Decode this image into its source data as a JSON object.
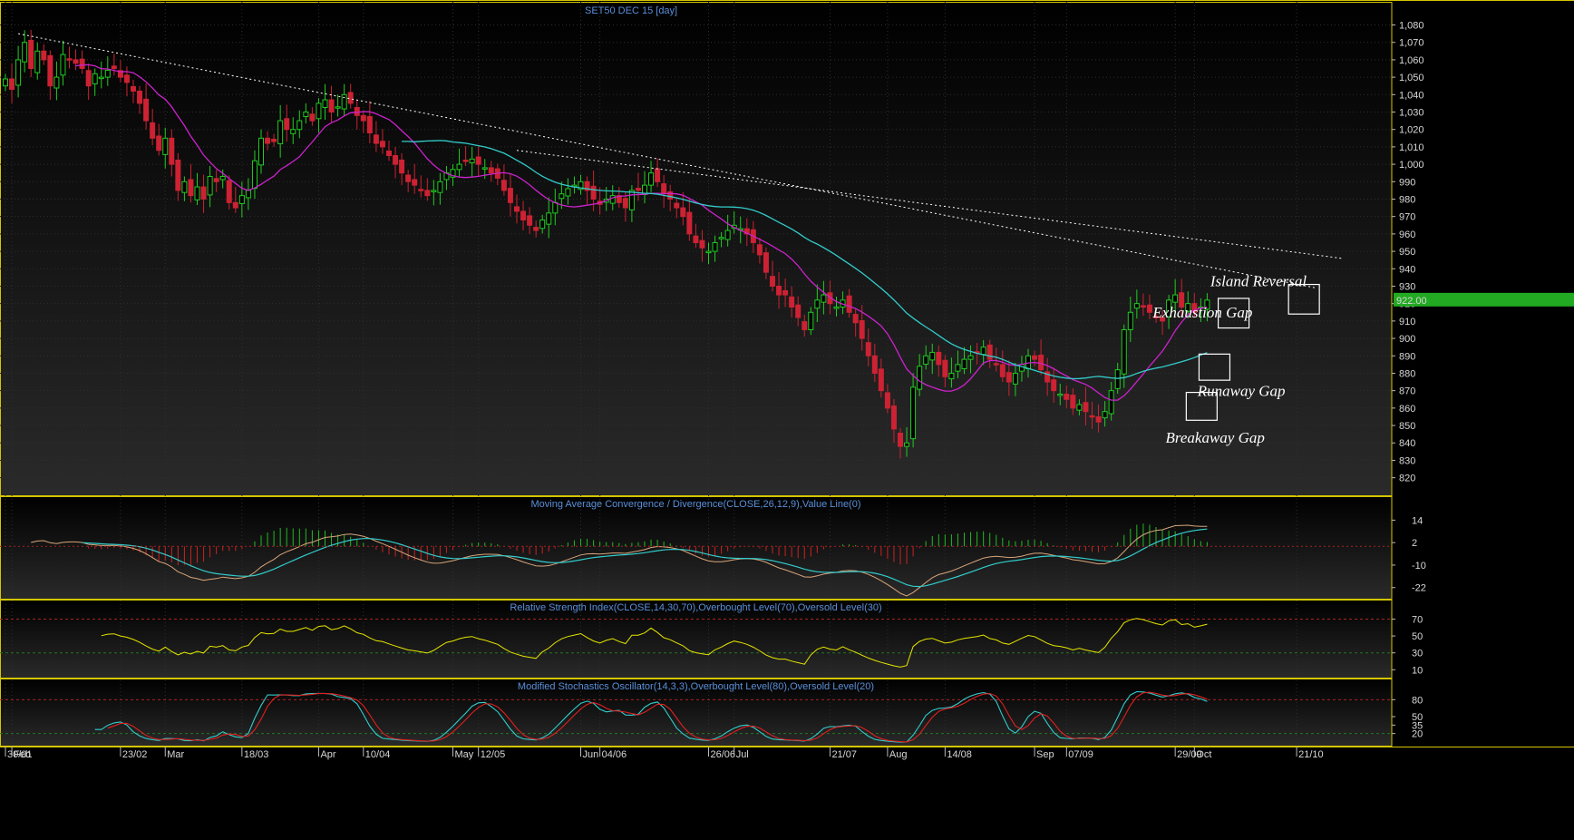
{
  "chart_data": [
    {
      "type": "candlestick",
      "panel": "price",
      "title": "SET50 DEC 15   [day]",
      "last_price_label": "922.00",
      "yticks": [
        820,
        830,
        840,
        850,
        860,
        870,
        880,
        890,
        900,
        910,
        920,
        930,
        940,
        950,
        960,
        970,
        980,
        990,
        1000,
        1010,
        1020,
        1030,
        1040,
        1050,
        1060,
        1070,
        1080
      ],
      "ytick_labels": [
        "820",
        "830",
        "840",
        "850",
        "860",
        "870",
        "880",
        "890",
        "900",
        "910",
        "920",
        "930",
        "940",
        "950",
        "960",
        "970",
        "980",
        "990",
        "1,000",
        "1,010",
        "1,020",
        "1,030",
        "1,040",
        "1,050",
        "1,060",
        "1,070",
        "1,080"
      ],
      "ylim": [
        812,
        1086
      ],
      "x_axis_labels": [
        {
          "bar": 0,
          "text": "30/01"
        },
        {
          "bar": 1,
          "text": "Feb"
        },
        {
          "bar": 18,
          "text": "23/02"
        },
        {
          "bar": 25,
          "text": "Mar"
        },
        {
          "bar": 37,
          "text": "18/03"
        },
        {
          "bar": 49,
          "text": "Apr"
        },
        {
          "bar": 56,
          "text": "10/04"
        },
        {
          "bar": 70,
          "text": "May"
        },
        {
          "bar": 74,
          "text": "12/05"
        },
        {
          "bar": 90,
          "text": "Jun"
        },
        {
          "bar": 93,
          "text": "04/06"
        },
        {
          "bar": 110,
          "text": "26/06"
        },
        {
          "bar": 114,
          "text": "Jul"
        },
        {
          "bar": 129,
          "text": "21/07"
        },
        {
          "bar": 138,
          "text": "Aug"
        },
        {
          "bar": 147,
          "text": "14/08"
        },
        {
          "bar": 161,
          "text": "Sep"
        },
        {
          "bar": 166,
          "text": "07/09"
        },
        {
          "bar": 183,
          "text": "29/09"
        },
        {
          "bar": 186,
          "text": "Oct"
        },
        {
          "bar": 202,
          "text": "21/10"
        }
      ],
      "close": [
        1049,
        1043,
        1060,
        1070,
        1055,
        1065,
        1060,
        1045,
        1050,
        1063,
        1060,
        1058,
        1055,
        1045,
        1052,
        1050,
        1054,
        1055,
        1050,
        1047,
        1042,
        1035,
        1025,
        1015,
        1008,
        1015,
        1000,
        985,
        990,
        982,
        987,
        980,
        993,
        990,
        993,
        978,
        975,
        982,
        985,
        1002,
        1015,
        1012,
        1013,
        1025,
        1020,
        1020,
        1025,
        1030,
        1025,
        1035,
        1037,
        1030,
        1033,
        1040,
        1035,
        1028,
        1025,
        1018,
        1012,
        1010,
        1005,
        1000,
        995,
        990,
        988,
        985,
        982,
        985,
        990,
        995,
        997,
        1000,
        1002,
        1003,
        1000,
        998,
        995,
        992,
        985,
        978,
        973,
        968,
        965,
        962,
        968,
        972,
        978,
        983,
        986,
        988,
        990,
        985,
        980,
        977,
        980,
        982,
        978,
        975,
        985,
        985,
        988,
        995,
        990,
        983,
        980,
        975,
        970,
        960,
        955,
        952,
        950,
        955,
        958,
        962,
        965,
        963,
        960,
        955,
        948,
        938,
        930,
        925,
        925,
        918,
        912,
        905,
        915,
        922,
        925,
        920,
        918,
        922,
        915,
        909,
        900,
        890,
        880,
        870,
        860,
        848,
        838,
        840,
        872,
        884,
        890,
        892,
        885,
        878,
        880,
        885,
        888,
        890,
        892,
        895,
        888,
        885,
        878,
        875,
        880,
        885,
        890,
        888,
        882,
        875,
        870,
        868,
        865,
        860,
        862,
        858,
        855,
        852,
        858,
        870,
        882,
        905,
        915,
        920,
        918,
        915,
        912,
        910,
        922,
        925,
        918,
        920,
        915,
        918,
        922
      ],
      "ma_magenta_period": "approx 20-day",
      "ma_cyan_period": "approx 50-day",
      "annotations": [
        {
          "text": "Island Reversal",
          "bar": 197,
          "price": 930
        },
        {
          "text": "Exhaustion Gap",
          "bar": 188,
          "price": 912
        },
        {
          "text": "Runaway Gap",
          "bar": 195,
          "price": 867
        },
        {
          "text": "Breakaway Gap",
          "bar": 190,
          "price": 840
        }
      ],
      "gap_boxes": [
        {
          "bar": 187,
          "low": 853,
          "high": 862
        },
        {
          "bar": 189,
          "low": 876,
          "high": 884
        },
        {
          "bar": 192,
          "low": 906,
          "high": 916
        },
        {
          "bar": 203,
          "low": 914,
          "high": 924
        }
      ],
      "trendlines": [
        {
          "from_bar": 2,
          "from_price": 1075,
          "to_bar": 205,
          "to_price": 929
        },
        {
          "from_bar": 80,
          "from_price": 1008,
          "to_bar": 209,
          "to_price": 946
        }
      ]
    },
    {
      "type": "line",
      "panel": "macd",
      "title": "Moving Average Convergence / Divergence(CLOSE,26,12,9),Value Line(0)",
      "yticks": [
        14,
        2,
        -10,
        -22
      ],
      "ylim": [
        -26,
        20
      ],
      "colors": {
        "macd": "#d9a57a",
        "signal": "#33cccc",
        "hist_pos": "#22bb22",
        "hist_neg": "#cc2222"
      }
    },
    {
      "type": "line",
      "panel": "rsi",
      "title": "Relative Strength Index(CLOSE,14,30,70),Overbought Level(70),Oversold Level(30)",
      "yticks": [
        70,
        50,
        30,
        10
      ],
      "ylim": [
        5,
        78
      ],
      "overbought": 70,
      "oversold": 30,
      "color": "#e6e600"
    },
    {
      "type": "line",
      "panel": "stochastic",
      "title": "Modified Stochastics Oscillator(14,3,3),Overbought Level(80),Oversold Level(20)",
      "yticks": [
        80,
        50,
        35,
        20
      ],
      "ylim": [
        5,
        95
      ],
      "overbought": 80,
      "oversold": 20,
      "colors": {
        "k": "#33cccc",
        "d": "#e02020"
      }
    }
  ],
  "colors": {
    "background": "#000000",
    "frame": "#d4c600",
    "up_candle": "#22cc22",
    "down_candle": "#cc2233",
    "title_text": "#5a8fd9",
    "ma_fast": "#cc22cc",
    "ma_slow": "#33cccc",
    "trendline": "#ffffff",
    "last_price_tag": "#22aa22"
  }
}
